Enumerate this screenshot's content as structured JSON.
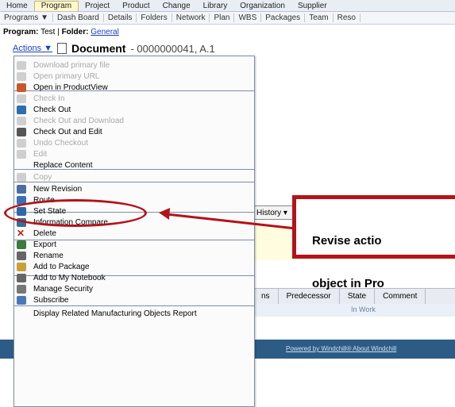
{
  "top_tabs": [
    "Home",
    "Program",
    "Project",
    "Product",
    "Change",
    "Library",
    "Organization",
    "Supplier"
  ],
  "active_tab": "Program",
  "sub_tabs": [
    "Programs ▼",
    "Dash Board",
    "Details",
    "Folders",
    "Network",
    "Plan",
    "WBS",
    "Packages",
    "Team",
    "Reso"
  ],
  "context": {
    "program_label": "Program:",
    "program_value": "Test",
    "folder_label": "Folder:",
    "folder_link": "General"
  },
  "document": {
    "actions_label": "Actions ▼",
    "title": "Document",
    "number": "- 0000000041, A.1"
  },
  "menu_items": [
    {
      "label": "Download primary file",
      "disabled": true,
      "icon": "download-icon"
    },
    {
      "label": "Open primary URL",
      "disabled": true,
      "icon": "url-icon"
    },
    {
      "label": "Open in ProductView",
      "disabled": false,
      "icon": "productview-icon"
    },
    {
      "label": "Check In",
      "disabled": true,
      "icon": "checkin-icon"
    },
    {
      "label": "Check Out",
      "disabled": false,
      "icon": "checkout-icon"
    },
    {
      "label": "Check Out and Download",
      "disabled": true,
      "icon": "checkout-download-icon"
    },
    {
      "label": "Check Out and Edit",
      "disabled": false,
      "icon": "pencil-icon"
    },
    {
      "label": "Undo Checkout",
      "disabled": true,
      "icon": "undo-checkout-icon"
    },
    {
      "label": "Edit",
      "disabled": true,
      "icon": "edit-icon"
    },
    {
      "label": "Replace Content",
      "disabled": false,
      "icon": ""
    },
    {
      "label": "Copy",
      "disabled": true,
      "icon": "copy-icon"
    },
    {
      "label": "New Revision",
      "disabled": false,
      "icon": "revise-icon"
    },
    {
      "label": "Route",
      "disabled": false,
      "icon": "route-icon"
    },
    {
      "label": "Set State",
      "disabled": false,
      "icon": "state-icon"
    },
    {
      "label": "Information Compare",
      "disabled": false,
      "icon": "compare-icon"
    },
    {
      "label": "Delete",
      "disabled": false,
      "icon": "delete-icon"
    },
    {
      "label": "Export",
      "disabled": false,
      "icon": "export-icon"
    },
    {
      "label": "Rename",
      "disabled": false,
      "icon": "rename-icon"
    },
    {
      "label": "Add to Package",
      "disabled": false,
      "icon": "package-icon"
    },
    {
      "label": "Add to My Notebook",
      "disabled": false,
      "icon": "notebook-icon"
    },
    {
      "label": "Manage Security",
      "disabled": false,
      "icon": "security-icon"
    },
    {
      "label": "Subscribe",
      "disabled": false,
      "icon": "subscribe-icon"
    },
    {
      "label": "Display Related Manufacturing Objects Report",
      "disabled": false,
      "icon": ""
    }
  ],
  "history_label": "History ▾",
  "table": {
    "headers": [
      "ns",
      "Predecessor",
      "State",
      "Comment"
    ],
    "row_state": "In Work"
  },
  "footer_links": "Powered by Windchill®   About Windchill",
  "callout": {
    "line1": "Revise actio",
    "line2": "object in Pro"
  },
  "colors": {
    "callout_red": "#b3131b",
    "footer_blue": "#2c5c86",
    "link_blue": "#1b3fbf"
  }
}
